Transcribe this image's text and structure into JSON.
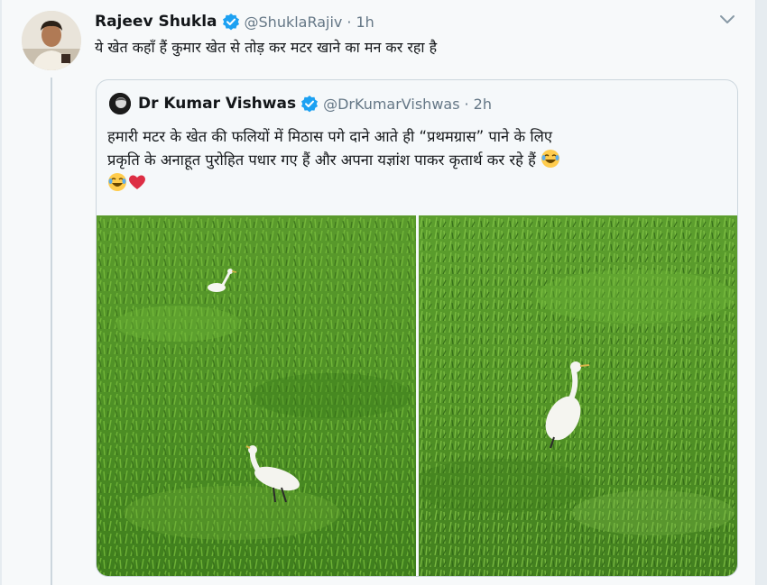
{
  "tweet": {
    "author_name": "Rajeev Shukla",
    "author_handle": "@ShuklaRajiv",
    "separator": "·",
    "time": "1h",
    "text": "ये खेत कहाँ हैं कुमार खेत से तोड़ कर मटर खाने का मन कर रहा है",
    "avatar_icon": "user-photo",
    "verified_icon": "verified-badge-icon",
    "caret_icon": "chevron-down-icon"
  },
  "quoted": {
    "author_name": "Dr Kumar Vishwas",
    "author_handle": "@DrKumarVishwas",
    "separator": "·",
    "time": "2h",
    "text_line1": "हमारी मटर के खेत की फलियों में मिठास पगे दाने आते ही “प्रथमग्रास” पाने के लिए",
    "text_line2": "प्रकृति के अनाहूत पुरोहित पधार गए हैं और अपना यज्ञांश पाकर कृतार्थ कर रहे हैं",
    "emojis": [
      "laughing-tears-emoji",
      "laughing-tears-emoji",
      "red-heart-emoji"
    ],
    "media": [
      "egrets-in-pea-field-photo-1",
      "egret-in-pea-field-photo-2"
    ]
  },
  "colors": {
    "accent": "#1da1f2",
    "muted": "#657786",
    "background": "#f7f9fa",
    "border": "#ccd6dd"
  }
}
